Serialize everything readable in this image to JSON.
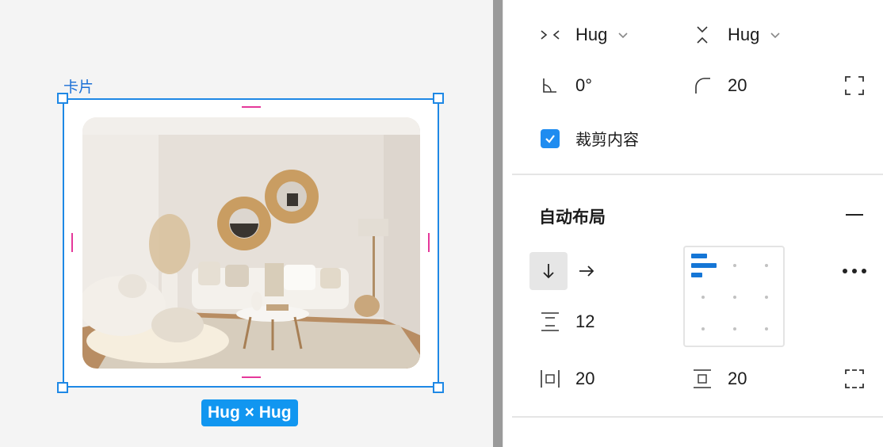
{
  "canvas": {
    "frame_label": "卡片",
    "size_badge": "Hug × Hug",
    "image_alt": "living room photo"
  },
  "panel": {
    "width_mode": "Hug",
    "height_mode": "Hug",
    "rotation": "0°",
    "corner_radius": "20",
    "clip_content_label": "裁剪内容",
    "clip_content_checked": true,
    "auto_layout_title": "自动布局",
    "gap": "12",
    "horizontal_padding": "20",
    "vertical_padding": "20",
    "direction_selected": "vertical",
    "alignment": "top-left"
  },
  "colors": {
    "selection": "#1e88e5",
    "padding_marker": "#e5389a",
    "accent": "#1576d6"
  }
}
